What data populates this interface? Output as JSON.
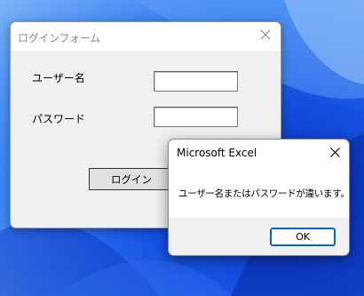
{
  "login_form": {
    "title": "ログインフォーム",
    "username_label": "ユーザー名",
    "username_value": "",
    "password_label": "パスワード",
    "password_value": "",
    "login_button": "ログイン"
  },
  "message_box": {
    "title": "Microsoft Excel",
    "message": "ユーザー名またはパスワードが違います。",
    "ok_button": "OK"
  },
  "icons": {
    "close": "close-icon"
  },
  "colors": {
    "wallpaper_blue": "#1450e0",
    "accent": "#0067c0",
    "dialog_background": "#f0f0f0"
  }
}
